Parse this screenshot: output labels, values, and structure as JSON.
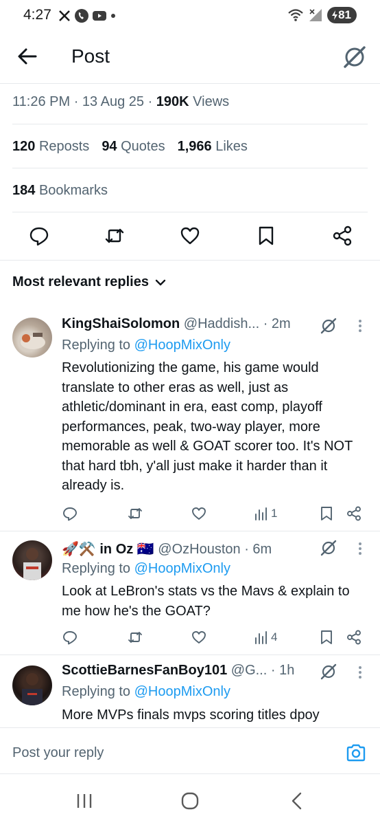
{
  "status_bar": {
    "time": "4:27",
    "battery": "81",
    "icons": [
      "x-logo-icon",
      "phone-icon",
      "youtube-icon",
      "dot-icon",
      "wifi-icon",
      "signal-icon",
      "battery-icon"
    ]
  },
  "header": {
    "title": "Post",
    "back_icon": "back-arrow-icon",
    "grok_icon": "grok-icon"
  },
  "post_meta": {
    "time": "11:26 PM",
    "date": "13 Aug 25",
    "views_count": "190K",
    "views_label": "Views"
  },
  "post_stats": {
    "reposts_count": "120",
    "reposts_label": "Reposts",
    "quotes_count": "94",
    "quotes_label": "Quotes",
    "likes_count": "1,966",
    "likes_label": "Likes",
    "bookmarks_count": "184",
    "bookmarks_label": "Bookmarks"
  },
  "sort": {
    "label": "Most relevant replies"
  },
  "replies": [
    {
      "name": "KingShaiSolomon",
      "handle": "@Haddish...",
      "time": "· 2m",
      "replying_prefix": "Replying to",
      "replying_to": "@HoopMixOnly",
      "text": "Revolutionizing the game, his game would translate to other eras as well, just as athletic/dominant in era, east comp, playoff performances, peak, two-way player, more memorable as well & GOAT scorer too. It's NOT that hard tbh, y'all just make it harder than it already is.",
      "views": "1"
    },
    {
      "name": "🚀⚒️ in Oz 🇦🇺",
      "handle": "@OzHouston · 6m",
      "time": "",
      "replying_prefix": "Replying to",
      "replying_to": "@HoopMixOnly",
      "text": "Look at LeBron's stats vs the Mavs & explain to me how he's the GOAT?",
      "views": "4"
    },
    {
      "name": "ScottieBarnesFanBoy101",
      "handle": "@G...",
      "time": "· 1h",
      "replying_prefix": "Replying to",
      "replying_to": "@HoopMixOnly",
      "text": "More MVPs finals mvps scoring titles dpoy",
      "views": ""
    }
  ],
  "composer": {
    "placeholder": "Post your reply"
  },
  "colors": {
    "accent": "#1d9bf0",
    "text": "#0f1419",
    "muted": "#536471",
    "divider": "#e6e9ec"
  }
}
